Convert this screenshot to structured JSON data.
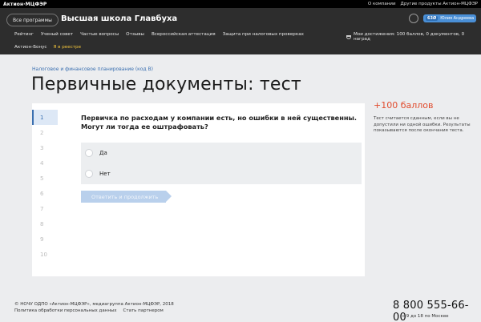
{
  "topbar": {
    "logo": "Актион·МЦФЭР",
    "links": [
      "О компании",
      "Другие продукты Актион-МЦФЭР"
    ]
  },
  "header": {
    "all_programs": "Все программы",
    "school_title": "Высшая школа Главбуха",
    "user": {
      "badge": "63Ø",
      "name": "Юлия Андреева"
    },
    "nav": [
      "Рейтинг",
      "Ученый совет",
      "Частые вопросы",
      "Отзывы",
      "Всероссийская аттестация",
      "Защита при налоговых проверках"
    ],
    "achievements": "Мои достижения: 100 баллов, 0 документов, 0 наград",
    "subnav": [
      "Актион-Бонус",
      "Я в реестре"
    ]
  },
  "page": {
    "breadcrumb": "Налоговое и финансовое планирование (код В)",
    "title": "Первичные документы: тест"
  },
  "test": {
    "steps": [
      "1",
      "2",
      "3",
      "4",
      "5",
      "6",
      "7",
      "8",
      "9",
      "10"
    ],
    "active_step": 1,
    "question": "Первичка по расходам у компании есть, но ошибки в ней существенны. Могут ли тогда ее оштрафовать?",
    "answers": [
      "Да",
      "Нет"
    ],
    "submit_label": "Ответить и продолжить"
  },
  "side": {
    "points": "+100 баллов",
    "note": "Тест считается сданным, если вы не допустили ни одной ошибки. Результаты показываются после окончания теста."
  },
  "footer": {
    "copyright": "© НОЧУ ОДПО «Актион-МЦФЭР», медиагруппа Актион-МЦФЭР, 2018",
    "links": [
      "Политика обработки персональных данных",
      "Стать партнером"
    ],
    "phone": "8 800 555-66-00",
    "phone_hours": "с 9 до 18 по Москве"
  },
  "colors": {
    "accent": "#3a6fb0",
    "points": "#e14b2d",
    "header_bg": "#2d2d2d",
    "highlight": "#f2c43b"
  }
}
